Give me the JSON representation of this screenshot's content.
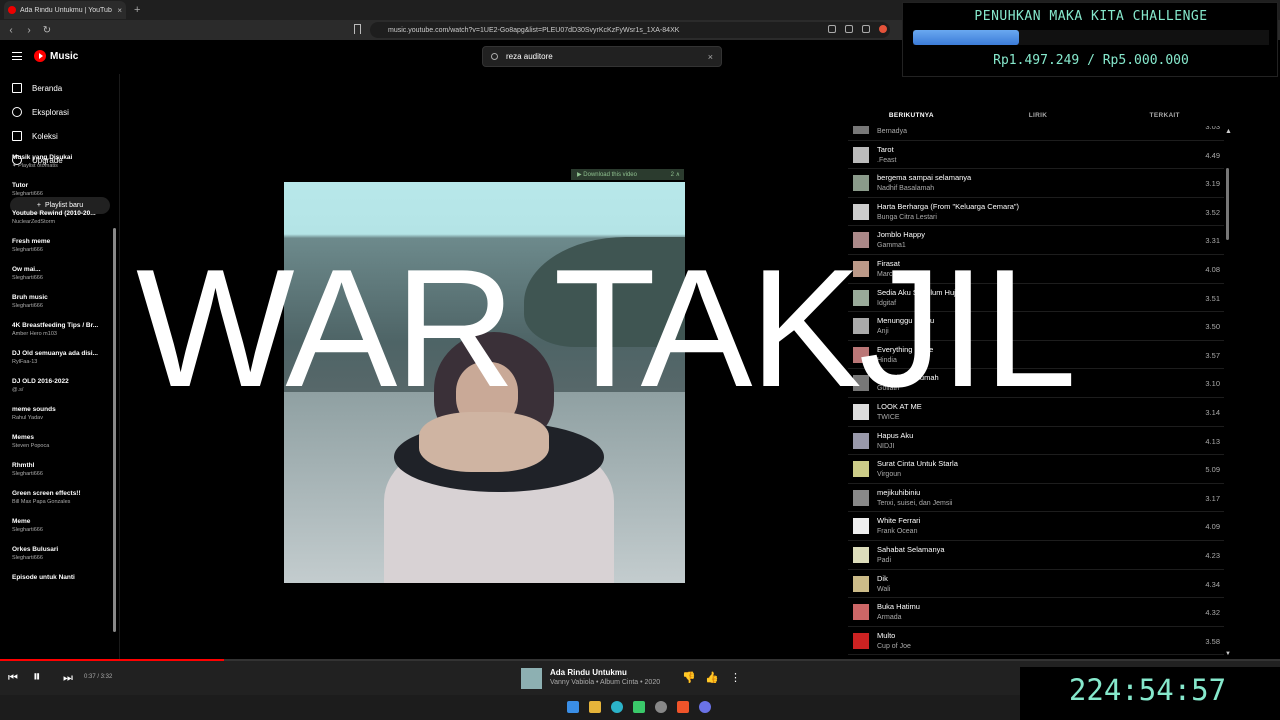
{
  "browser": {
    "tab_title": "Ada Rindu Untukmu | YouTub",
    "tab_close": "×",
    "new_tab": "+",
    "url": "music.youtube.com/watch?v=1UE2-Go8apg&list=PLEU07dD30SvyrKcKzFyWsr1s_1XA-84XK"
  },
  "header": {
    "logo": "Music",
    "search_value": "reza auditore",
    "search_clear": "×"
  },
  "sidebar": {
    "nav": [
      {
        "label": "Beranda",
        "icon": "home-icon"
      },
      {
        "label": "Eksplorasi",
        "icon": "explore-icon"
      },
      {
        "label": "Koleksi",
        "icon": "library-icon"
      },
      {
        "label": "Upgrade",
        "icon": "upgrade-icon"
      }
    ],
    "new_playlist": "Playlist baru",
    "playlists": [
      {
        "title": "Musik yang Disukai",
        "sub": "✦ Playlist otomatis"
      },
      {
        "title": "Tutor",
        "sub": "Slegharti666"
      },
      {
        "title": "Youtube Rewind (2010-20...",
        "sub": "NuclearZedStorm"
      },
      {
        "title": "Fresh meme",
        "sub": "Slegharti666"
      },
      {
        "title": "Ow mai...",
        "sub": "Slegharti666"
      },
      {
        "title": "Bruh music",
        "sub": "Slegharti666"
      },
      {
        "title": "4K Breastfeeding Tips / Br...",
        "sub": "Amber Hero m103"
      },
      {
        "title": "DJ Old semuanya ada disi...",
        "sub": "RylFaa-13"
      },
      {
        "title": "DJ OLD 2016-2022",
        "sub": "@.s/"
      },
      {
        "title": "meme sounds",
        "sub": "Rahul Yadav"
      },
      {
        "title": "Memes",
        "sub": "Steven Popoca"
      },
      {
        "title": "Rhmthl",
        "sub": "Slegharti666"
      },
      {
        "title": "Green screen effects!!",
        "sub": "Bill Max Papa Gonzales"
      },
      {
        "title": "Meme",
        "sub": "Slegharti666"
      },
      {
        "title": "Orkes Bulusari",
        "sub": "Slegharti666"
      },
      {
        "title": "Episode untuk Nanti",
        "sub": ""
      }
    ]
  },
  "video": {
    "download_label": "▶ Download this video",
    "download_extra": "2 ∧",
    "overlay_text": "WAR TAKJIL"
  },
  "queue": {
    "tabs": [
      "BERIKUTNYA",
      "LIRIK",
      "TERKAIT"
    ],
    "items": [
      {
        "title": "",
        "artist": "Bernadya",
        "duration": "3.03"
      },
      {
        "title": "Tarot",
        "artist": ".Feast",
        "duration": "4.49"
      },
      {
        "title": "bergema sampai selamanya",
        "artist": "Nadhif Basalamah",
        "duration": "3.19"
      },
      {
        "title": "Harta Berharga (From \"Keluarga Cemara\")",
        "artist": "Bunga Citra Lestari",
        "duration": "3.52"
      },
      {
        "title": "Jomblo Happy",
        "artist": "Gamma1",
        "duration": "3.31"
      },
      {
        "title": "Firasat",
        "artist": "Marcell",
        "duration": "4.08"
      },
      {
        "title": "Sedia Aku Sebelum Hujan",
        "artist": "Idgitaf",
        "duration": "3.51"
      },
      {
        "title": "Menunggu Kamu",
        "artist": "Anji",
        "duration": "3.50"
      },
      {
        "title": "Everything U Are",
        "artist": "Hindia",
        "duration": "3.57"
      },
      {
        "title": "Rumah Ke Rumah",
        "artist": "Goliath",
        "duration": "3.10"
      },
      {
        "title": "LOOK AT ME",
        "artist": "TWICE",
        "duration": "3.14"
      },
      {
        "title": "Hapus Aku",
        "artist": "NIDJI",
        "duration": "4.13"
      },
      {
        "title": "Surat Cinta Untuk Starla",
        "artist": "Virgoun",
        "duration": "5.09"
      },
      {
        "title": "mejikuhibiniu",
        "artist": "Tenxi, suisei, dan Jemsii",
        "duration": "3.17"
      },
      {
        "title": "White Ferrari",
        "artist": "Frank Ocean",
        "duration": "4.09"
      },
      {
        "title": "Sahabat Selamanya",
        "artist": "Padi",
        "duration": "4.23"
      },
      {
        "title": "Dik",
        "artist": "Wali",
        "duration": "4.34"
      },
      {
        "title": "Buka Hatimu",
        "artist": "Armada",
        "duration": "4.32"
      },
      {
        "title": "Multo",
        "artist": "Cup of Joe",
        "duration": "3.58"
      }
    ]
  },
  "player": {
    "time": "0:37 / 3:32",
    "progress": 0.175,
    "title": "Ada Rindu Untukmu",
    "subtitle": "Vanny Vabiola • Album Cinta • 2020"
  },
  "challenge": {
    "title": "PENUHKAN MAKA KITA CHALLENGE",
    "progress": 0.299,
    "amount": "Rp1.497.249 / Rp5.000.000"
  },
  "timer": "224:54:57",
  "colors": {
    "accent": "#86e8cc",
    "progress_red": "#ff0000",
    "bar_blue": "#3b7bd8"
  }
}
